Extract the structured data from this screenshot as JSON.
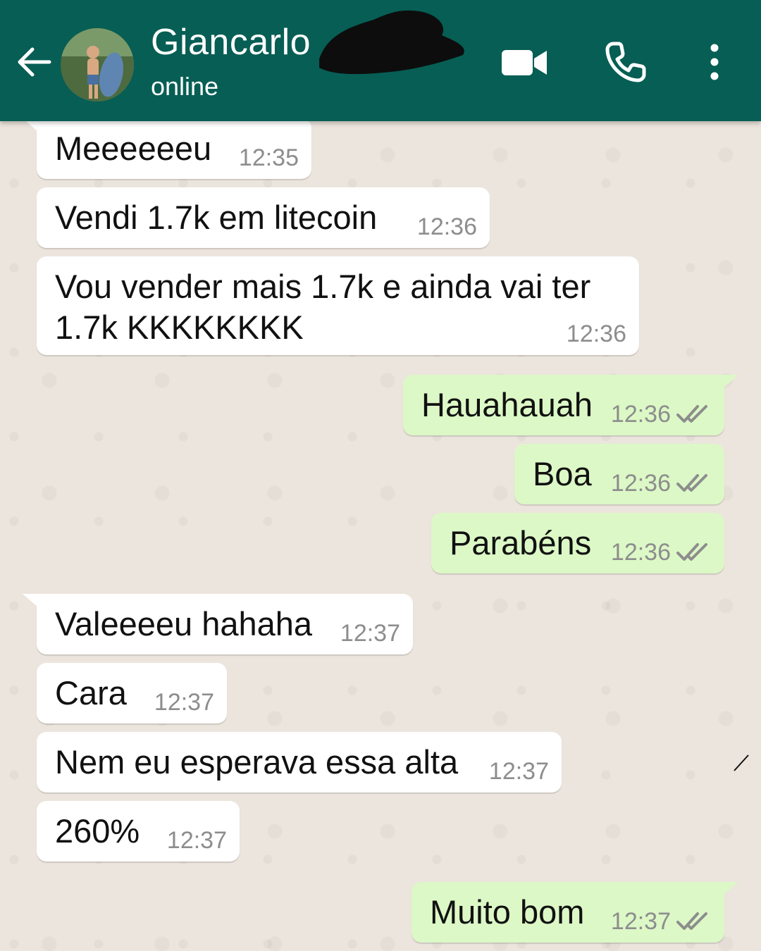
{
  "header": {
    "contact_name": "Giancarlo",
    "status": "online",
    "color": "#075e54",
    "icons": [
      "back-arrow-icon",
      "avatar",
      "video-call-icon",
      "phone-call-icon",
      "more-options-icon"
    ]
  },
  "messages": [
    {
      "direction": "incoming",
      "text": "Meeeeeeu",
      "time": "12:35"
    },
    {
      "direction": "incoming",
      "text": "Vendi 1.7k em litecoin",
      "time": "12:36"
    },
    {
      "direction": "incoming",
      "text_line1": "Vou vender mais 1.7k e ainda vai ter",
      "text_line2": "1.7k KKKKKKKK",
      "time": "12:36"
    },
    {
      "direction": "outgoing",
      "text": "Hauahauah",
      "time": "12:36",
      "status": "read"
    },
    {
      "direction": "outgoing",
      "text": "Boa",
      "time": "12:36",
      "status": "read"
    },
    {
      "direction": "outgoing",
      "text": "Parabéns",
      "time": "12:36",
      "status": "read"
    },
    {
      "direction": "incoming",
      "text": "Valeeeeu hahaha",
      "time": "12:37"
    },
    {
      "direction": "incoming",
      "text": "Cara",
      "time": "12:37"
    },
    {
      "direction": "incoming",
      "text": "Nem eu esperava essa alta",
      "time": "12:37"
    },
    {
      "direction": "incoming",
      "text": "260%",
      "time": "12:37"
    },
    {
      "direction": "outgoing",
      "text": "Muito bom",
      "time": "12:37",
      "status": "read"
    }
  ],
  "colors": {
    "incoming_bubble": "#ffffff",
    "outgoing_bubble": "#dcf8c6",
    "background": "#ece5dd",
    "ticks": "#8d8d8d"
  }
}
